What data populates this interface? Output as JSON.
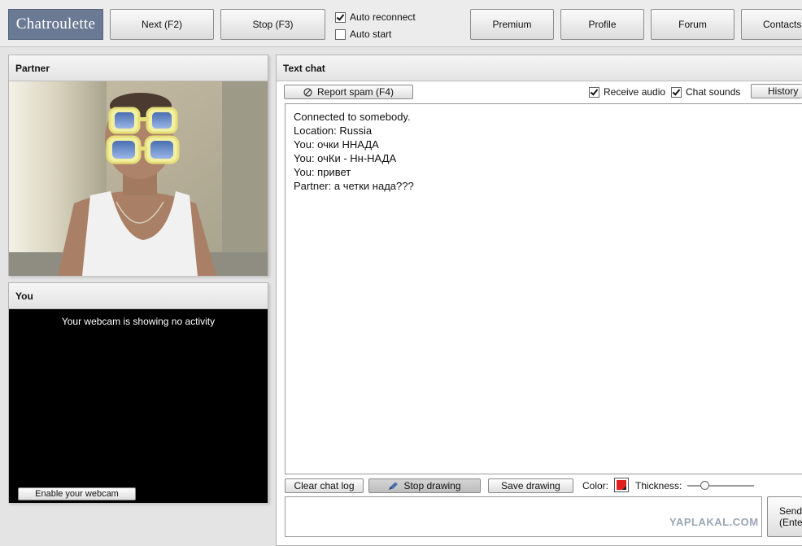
{
  "brand": {
    "logo_text": "Chatroulette"
  },
  "toolbar": {
    "next_label": "Next (F2)",
    "stop_label": "Stop (F3)",
    "auto_reconnect_label": "Auto reconnect",
    "auto_reconnect_checked": true,
    "auto_start_label": "Auto start",
    "auto_start_checked": false,
    "premium_label": "Premium",
    "profile_label": "Profile",
    "forum_label": "Forum",
    "contacts_label": "Contacts"
  },
  "partner_panel": {
    "title": "Partner"
  },
  "you_panel": {
    "title": "You",
    "status_text": "Your webcam is showing no activity",
    "enable_button_label": "Enable your webcam"
  },
  "text_chat": {
    "title": "Text chat",
    "report_spam_label": "Report spam (F4)",
    "receive_audio_label": "Receive audio",
    "receive_audio_checked": true,
    "chat_sounds_label": "Chat sounds",
    "chat_sounds_checked": true,
    "history_label": "History",
    "messages": [
      "Connected to somebody.",
      "",
      "Location: Russia",
      "",
      "You: очки ННАДА",
      "You: очКи - Нн-НАДА",
      "You: привет",
      "Partner: а четки нада???"
    ],
    "clear_log_label": "Clear chat log",
    "stop_drawing_label": "Stop drawing",
    "save_drawing_label": "Save drawing",
    "color_label": "Color:",
    "color_value": "#e02020",
    "thickness_label": "Thickness:",
    "thickness_value": 0.25,
    "message_value": "",
    "send_label_line1": "Send",
    "send_label_line2": "(Enter)"
  },
  "watermark": {
    "text": "YAPLAKAL.COM"
  },
  "colors": {
    "logo_bg": "#6b7a94",
    "panel_border": "#b5b5b5"
  }
}
